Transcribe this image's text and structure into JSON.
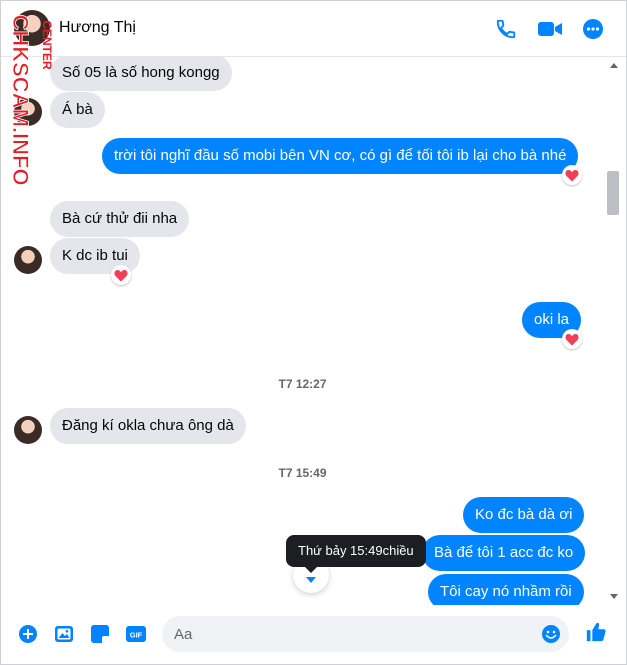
{
  "header": {
    "contact_name": "Hương Thị",
    "icons": [
      "phone-icon",
      "video-camera-icon",
      "more-options-icon"
    ]
  },
  "watermark": {
    "main_text": "CHKSCAM.INFO",
    "sub_text": "CENTER"
  },
  "messages": [
    {
      "text": "Số 05 là số hong kongg",
      "direction": "incoming"
    },
    {
      "text": "Á bà",
      "direction": "incoming"
    },
    {
      "text": "trời tôi nghĩ đầu số mobi bên VN cơ, có gì để tối tôi ib lại cho bà nhé",
      "direction": "outgoing",
      "reaction": "heart"
    },
    {
      "text": "Bà cứ thử đii nha",
      "direction": "incoming"
    },
    {
      "text": "K dc ib tui",
      "direction": "incoming",
      "reaction": "heart"
    },
    {
      "text": "oki la",
      "direction": "outgoing",
      "reaction": "heart"
    },
    {
      "text": "Đăng kí okla chưa ông dà",
      "direction": "incoming"
    },
    {
      "text": "Ko đc bà dà ơi",
      "direction": "outgoing"
    },
    {
      "text": "Bà để tôi 1 acc đc ko",
      "direction": "outgoing"
    },
    {
      "text": "Tôi cay nó nhầm rồi",
      "direction": "outgoing"
    }
  ],
  "timestamps": [
    "T7 12:27",
    "T7 15:49"
  ],
  "tooltip": "Thứ bảy 15:49chiều",
  "composer": {
    "placeholder": "Aa",
    "icons": [
      "add-icon",
      "photo-icon",
      "sticker-icon",
      "gif-icon",
      "emoji-icon",
      "like-icon"
    ],
    "gif_label": "GIF"
  },
  "colors": {
    "accent": "#0084ff",
    "incoming_bubble": "#e4e6eb",
    "heart": "#f33e58",
    "watermark_red": "#e41e26"
  }
}
